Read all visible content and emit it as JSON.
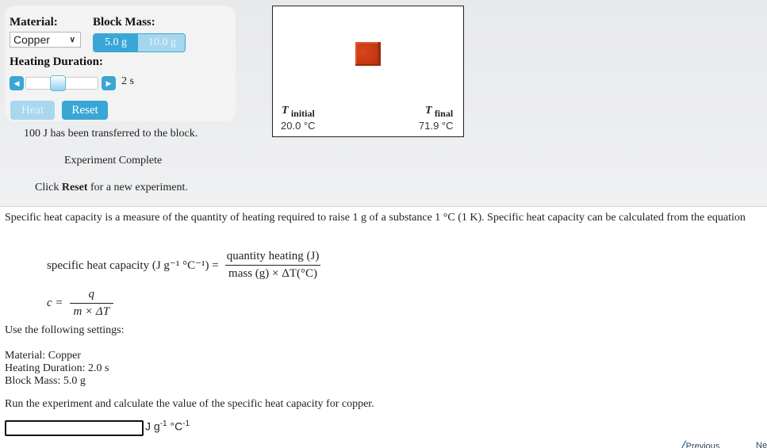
{
  "controls": {
    "material_label": "Material:",
    "material_value": "Copper",
    "block_mass_label": "Block Mass:",
    "mass_options": [
      "5.0 g",
      "10.0 g"
    ],
    "mass_selected": "5.0 g",
    "heating_duration_label": "Heating Duration:",
    "duration_value": "2 s",
    "heat_button": "Heat",
    "reset_button": "Reset"
  },
  "status": {
    "transferred": "100 J has been transferred to the block.",
    "complete": "Experiment Complete",
    "click_prefix": "Click ",
    "click_bold": "Reset",
    "click_suffix": " for a new experiment."
  },
  "display": {
    "t_symbol": "T",
    "initial_label": "initial",
    "initial_value": "20.0 °C",
    "final_label": "final",
    "final_value": "71.9 °C",
    "block_color": "#c33812"
  },
  "content": {
    "intro": "Specific heat capacity is a measure of the quantity of heating required to raise 1 g of a substance 1 °C (1 K). Specific heat capacity can be calculated from the equation",
    "formula1_lhs": "specific heat capacity (J g⁻¹ °C⁻¹) =",
    "formula1_num": "quantity heating (J)",
    "formula1_den": "mass (g) × ΔT(°C)",
    "formula2_lhs": "c =",
    "formula2_num": "q",
    "formula2_den": "m × ΔT",
    "settings_heading": "Use the following settings:",
    "setting_material": "Material: Copper",
    "setting_duration": "Heating Duration: 2.0 s",
    "setting_mass": "Block Mass: 5.0 g",
    "task": "Run the experiment and calculate the value of the specific heat capacity for copper.",
    "answer_value": "",
    "answer_unit": "J g",
    "answer_unit_exp1": "-1",
    "answer_unit_mid": " °C",
    "answer_unit_exp2": "-1"
  },
  "nav": {
    "previous": "Previous",
    "next": "Ne"
  },
  "colors": {
    "accent": "#39a6d6",
    "accent_disabled": "#a9d8ee"
  }
}
